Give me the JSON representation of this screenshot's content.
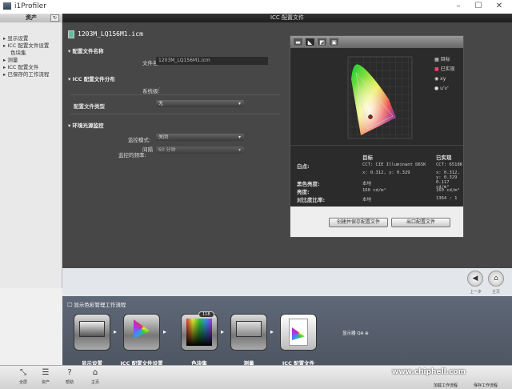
{
  "window": {
    "title": "i1Profiler",
    "minimize": "–",
    "maximize": "☐",
    "close": "✕"
  },
  "sidebar": {
    "header": "资产",
    "refresh": "↻",
    "items": [
      "显示设置",
      "ICC 配置文件设置",
      "色块集",
      "测量",
      "ICC 配置文件",
      "已保存的工作流程"
    ]
  },
  "main": {
    "header": "ICC 配置文件",
    "file_title": "1203M_LQ156M1.icm",
    "sections": {
      "name": "配置文件名称",
      "dist": "ICC 配置文件分布",
      "ambient": "环境光源监控"
    },
    "filename_label": "文件名:",
    "filename_value": "1203M_LQ156M1.icm",
    "system_label": "系统级:",
    "system_checked": "✓",
    "type_label": "配置文件类型",
    "type_value": "无",
    "monitor_label": "监控模式:",
    "monitor_value": "关闭",
    "interval_label1": "间隔",
    "interval_label2": "监控的频率:",
    "interval_value": "60 分钟"
  },
  "panel": {
    "tabs": [
      "▬",
      "◣",
      "◩",
      "▣"
    ],
    "legend": {
      "target": "目标",
      "achieved": "已实现",
      "xy": "xy",
      "uv": "u'v'"
    },
    "headers": {
      "target": "目标",
      "achieved": "已实现"
    },
    "rows": [
      {
        "label": "白点:",
        "target": "CCT: CIE Illuminant D65K",
        "achieved": "CCT: 6518K"
      },
      {
        "label": "",
        "target": "x: 0.312, y: 0.329",
        "achieved": "x: 0.312, y: 0.329"
      },
      {
        "label": "黑色亮度:",
        "target": "本地",
        "achieved": "0.117 cd/m²"
      },
      {
        "label": "亮度:",
        "target": "160 cd/m²",
        "achieved": "160 cd/m²"
      },
      {
        "label": "对比度比率:",
        "target": "本地",
        "achieved": "1364 : 1"
      }
    ],
    "create_button": "创建并保存配置文件",
    "export_button": "出口配置文件"
  },
  "nav": {
    "back": "◀",
    "home": "⌂",
    "back_label": "上一步",
    "home_label": "主页"
  },
  "workflow": {
    "title": "显示色彩管理工作流程",
    "badge": "118",
    "steps": [
      "显示设置",
      "ICC 配置文件设置",
      "色块集",
      "测量",
      "ICC 配置文件"
    ],
    "qa": "显示器 QA"
  },
  "bottom": {
    "items": [
      {
        "icon": "⤡",
        "label": "全屏"
      },
      {
        "icon": "☰",
        "label": "资产"
      },
      {
        "icon": "?",
        "label": "帮助"
      },
      {
        "icon": "⌂",
        "label": "主页"
      }
    ],
    "load": "加载工作流程",
    "save": "保存工作流程"
  },
  "watermark": "www.chiphell.com"
}
